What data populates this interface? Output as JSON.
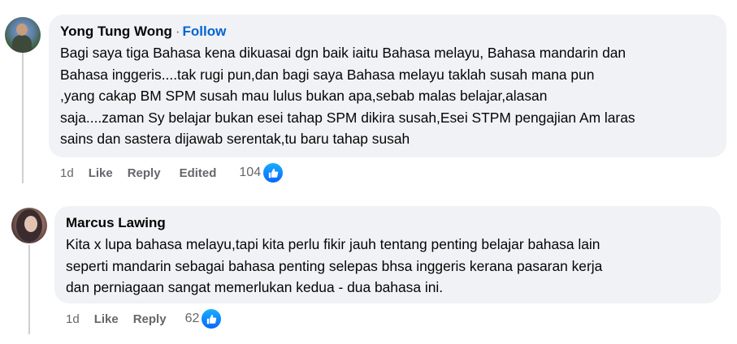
{
  "comments": [
    {
      "author": "Yong Tung Wong",
      "separator": "·",
      "follow_label": "Follow",
      "text": "Bagi saya tiga Bahasa kena dikuasai dgn baik iaitu Bahasa melayu, Bahasa mandarin dan\nBahasa inggeris....tak rugi pun,dan bagi saya Bahasa melayu taklah susah mana pun\n,yang cakap BM SPM susah mau lulus bukan apa,sebab malas belajar,alasan\nsaja....zaman Sy belajar bukan esei tahap SPM dikira susah,Esei STPM pengajian Am laras\nsains dan sastera dijawab serentak,tu baru tahap susah",
      "time": "1d",
      "like_label": "Like",
      "reply_label": "Reply",
      "edited_label": "Edited",
      "reaction_count": "104",
      "reaction_icon": "thumbs-up-icon",
      "reaction_color": "#0966ff"
    },
    {
      "author": "Marcus Lawing",
      "text": "Kita x lupa bahasa melayu,tapi kita perlu fikir jauh tentang penting belajar bahasa lain\nseperti mandarin sebagai bahasa penting selepas bhsa inggeris kerana pasaran kerja\ndan perniagaan sangat memerlukan kedua - dua bahasa ini.",
      "time": "1d",
      "like_label": "Like",
      "reply_label": "Reply",
      "reaction_count": "62",
      "reaction_icon": "thumbs-up-icon",
      "reaction_color": "#0966ff"
    }
  ],
  "colors": {
    "bubble_bg": "#f0f2f5",
    "follow_blue": "#0064d1",
    "meta_gray": "#65676b"
  }
}
